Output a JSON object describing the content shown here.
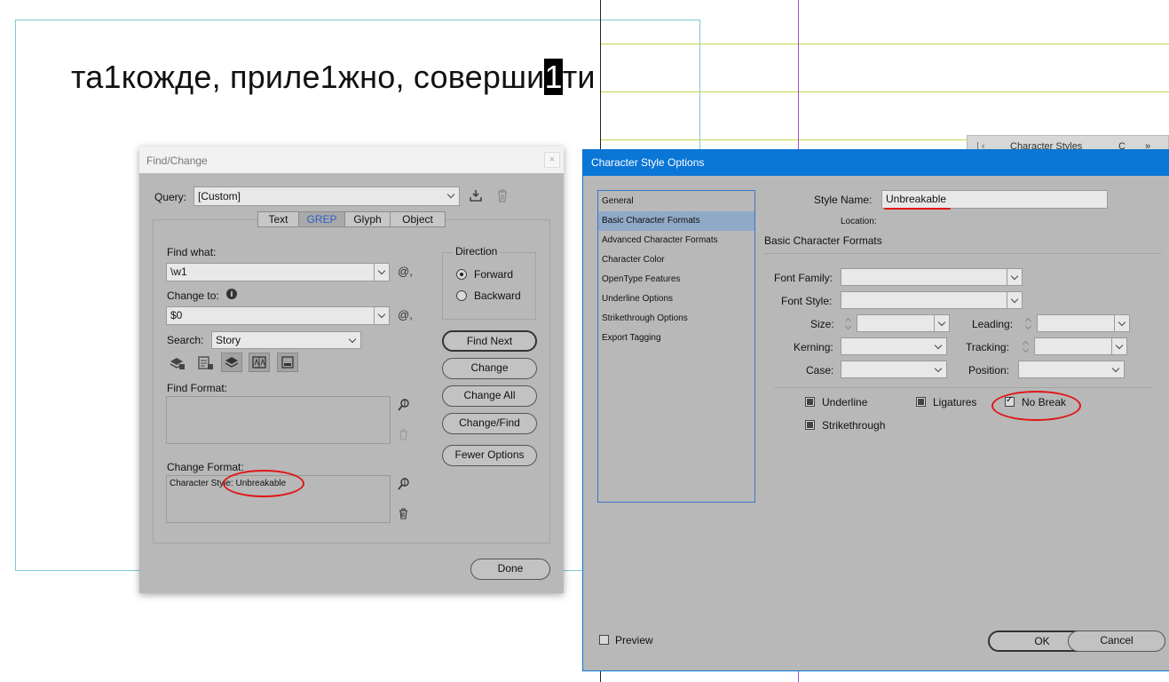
{
  "document": {
    "text_before": "та1кожде, приле1жно, соверши",
    "text_selected": "1",
    "text_after": "ти"
  },
  "panel_tab": {
    "label": "Character Styles",
    "more": "С"
  },
  "find_change": {
    "title": "Find/Change",
    "query_label": "Query:",
    "query_value": "[Custom]",
    "tabs": [
      {
        "label": "Text"
      },
      {
        "label": "GREP"
      },
      {
        "label": "Glyph"
      },
      {
        "label": "Object"
      }
    ],
    "active_tab": "GREP",
    "find_what_label": "Find what:",
    "find_what_value": "\\w1",
    "change_to_label": "Change to:",
    "change_to_value": "$0",
    "search_label": "Search:",
    "search_value": "Story",
    "direction_label": "Direction",
    "direction_forward": "Forward",
    "direction_backward": "Backward",
    "find_format_label": "Find Format:",
    "change_format_label": "Change Format:",
    "change_format_value": "Character Style: Unbreakable",
    "buttons": {
      "find_next": "Find Next",
      "change": "Change",
      "change_all": "Change All",
      "change_find": "Change/Find",
      "fewer_options": "Fewer Options",
      "done": "Done"
    },
    "special_char_symbol": "@,"
  },
  "char_style_options": {
    "title": "Character Style Options",
    "categories": [
      "General",
      "Basic Character Formats",
      "Advanced Character Formats",
      "Character Color",
      "OpenType Features",
      "Underline Options",
      "Strikethrough Options",
      "Export Tagging"
    ],
    "selected_category": "Basic Character Formats",
    "style_name_label": "Style Name:",
    "style_name_value": "Unbreakable",
    "location_label": "Location:",
    "section_title": "Basic Character Formats",
    "font_family_label": "Font Family:",
    "font_style_label": "Font Style:",
    "size_label": "Size:",
    "leading_label": "Leading:",
    "kerning_label": "Kerning:",
    "tracking_label": "Tracking:",
    "case_label": "Case:",
    "position_label": "Position:",
    "underline_label": "Underline",
    "ligatures_label": "Ligatures",
    "no_break_label": "No Break",
    "strikethrough_label": "Strikethrough",
    "preview_label": "Preview",
    "ok_label": "OK",
    "cancel_label": "Cancel"
  },
  "colors": {
    "dialog_bg": "#b8b8b8",
    "title_blue": "#0a76d6",
    "annotation_red": "#e01616",
    "list_border": "#3b78c8",
    "list_selected": "#90a9c7"
  }
}
